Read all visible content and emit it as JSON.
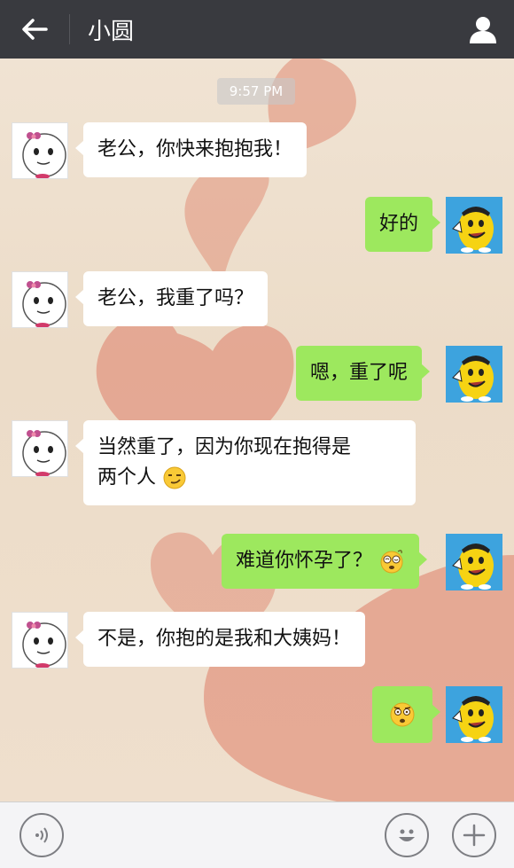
{
  "header": {
    "title": "小圆"
  },
  "chat": {
    "timestamp": "9:57 PM",
    "messages": [
      {
        "from": "contact",
        "text": "老公，你快来抱抱我！"
      },
      {
        "from": "me",
        "text": "好的"
      },
      {
        "from": "contact",
        "text": "老公，我重了吗？"
      },
      {
        "from": "me",
        "text": "嗯，重了呢"
      },
      {
        "from": "contact",
        "text_line1": "当然重了，因为你现在抱得是",
        "text_line2": "两个人",
        "emoji": "smirk-emoji"
      },
      {
        "from": "me",
        "text": "难道你怀孕了？",
        "emoji": "dizzy-emoji"
      },
      {
        "from": "contact",
        "text": "不是，你抱的是我和大姨妈！"
      },
      {
        "from": "me",
        "text": "",
        "emoji": "shocked-emoji"
      }
    ]
  },
  "input_bar": {
    "text_value": ""
  },
  "colors": {
    "header_bg": "#393a3f",
    "my_bubble": "#9de85e",
    "their_bubble": "#ffffff",
    "background": "#f1e4d3",
    "heart": "#de7e68"
  }
}
